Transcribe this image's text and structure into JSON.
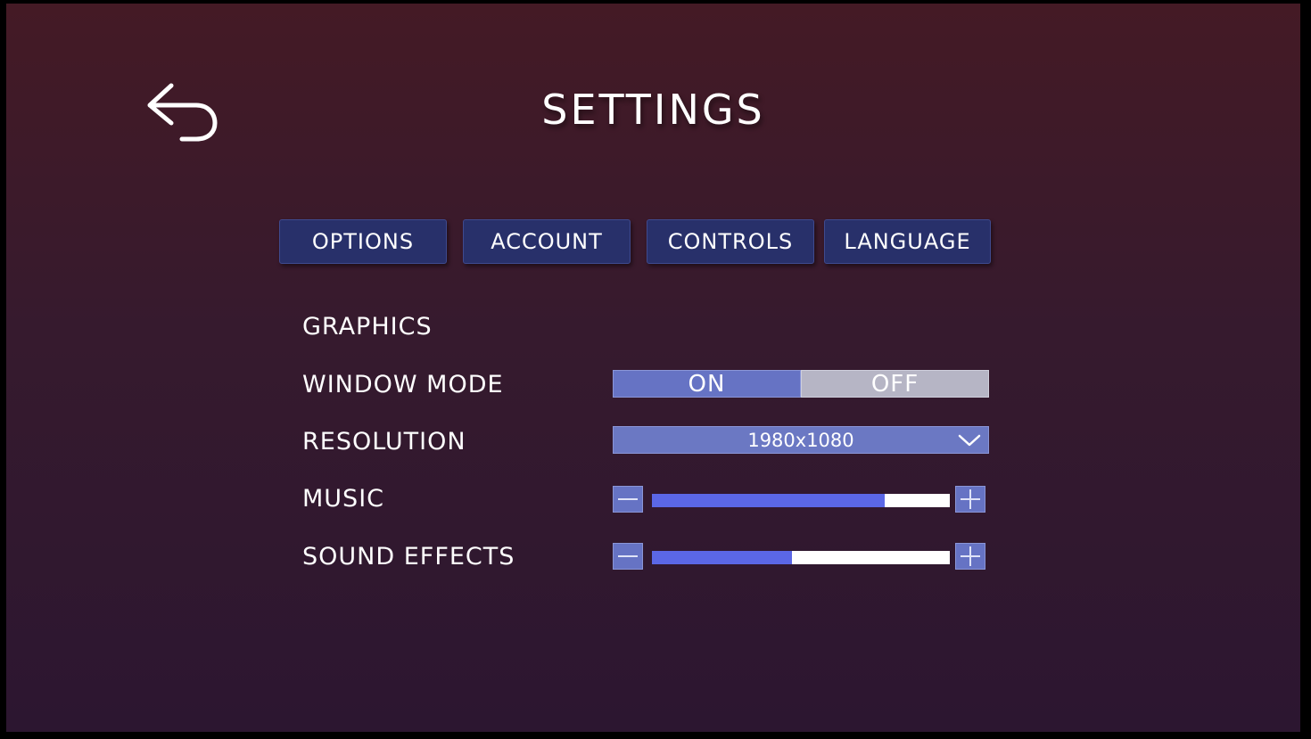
{
  "header": {
    "title": "SETTINGS",
    "back_icon": "undo-arrow-icon"
  },
  "tabs": [
    {
      "label": "OPTIONS"
    },
    {
      "label": "ACCOUNT"
    },
    {
      "label": "CONTROLS"
    },
    {
      "label": "LANGUAGE"
    }
  ],
  "graphics": {
    "section_title": "GRAPHICS",
    "window_mode": {
      "label": "WINDOW MODE",
      "on_label": "ON",
      "off_label": "OFF",
      "selected": "ON"
    },
    "resolution": {
      "label": "RESOLUTION",
      "value": "1980x1080",
      "icon": "chevron-down-icon"
    },
    "music": {
      "label": "MUSIC",
      "level": 0.78
    },
    "sound_effects": {
      "label": "SOUND EFFECTS",
      "level": 0.47
    }
  },
  "colors": {
    "tab_bg": "#28306a",
    "accent": "#6673c4",
    "slider_fill": "#5b67e6",
    "toggle_off": "#b6b5c5"
  }
}
